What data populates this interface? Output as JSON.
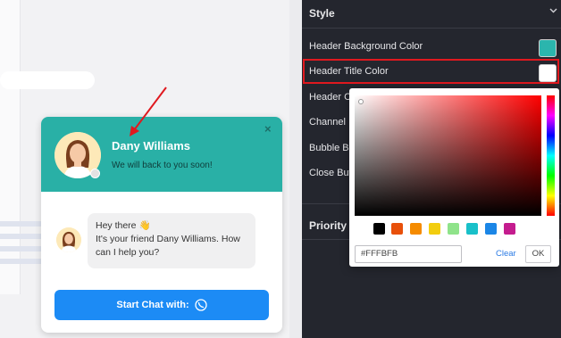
{
  "widget": {
    "agent_name": "Dany Williams",
    "subtitle": "We will back to you soon!",
    "close_glyph": "×",
    "message_lines": [
      "Hey there 👋",
      "It's your friend Dany Williams. How",
      "can I help you?"
    ],
    "start_button_label": "Start Chat with:",
    "header_color": "#29b0a6",
    "button_color": "#1c8bf5"
  },
  "panel": {
    "section_title": "Style",
    "rows": [
      {
        "label": "Header Background Color",
        "swatch": "#2bb5ad"
      },
      {
        "label": "Header Title Color",
        "swatch": "#ffffff"
      },
      {
        "label": "Header Ca"
      },
      {
        "label": "Channel Ic"
      },
      {
        "label": "Bubble Bu"
      },
      {
        "label": "Close Butt"
      }
    ],
    "priority_title": "Priority"
  },
  "color_picker": {
    "presets": [
      "#000000",
      "#e8500a",
      "#f58b00",
      "#f2cd0f",
      "#8fe38a",
      "#19c0c9",
      "#1b86e6",
      "#c41c8e"
    ],
    "hex_value": "#FFFBFB",
    "clear_label": "Clear",
    "ok_label": "OK"
  }
}
